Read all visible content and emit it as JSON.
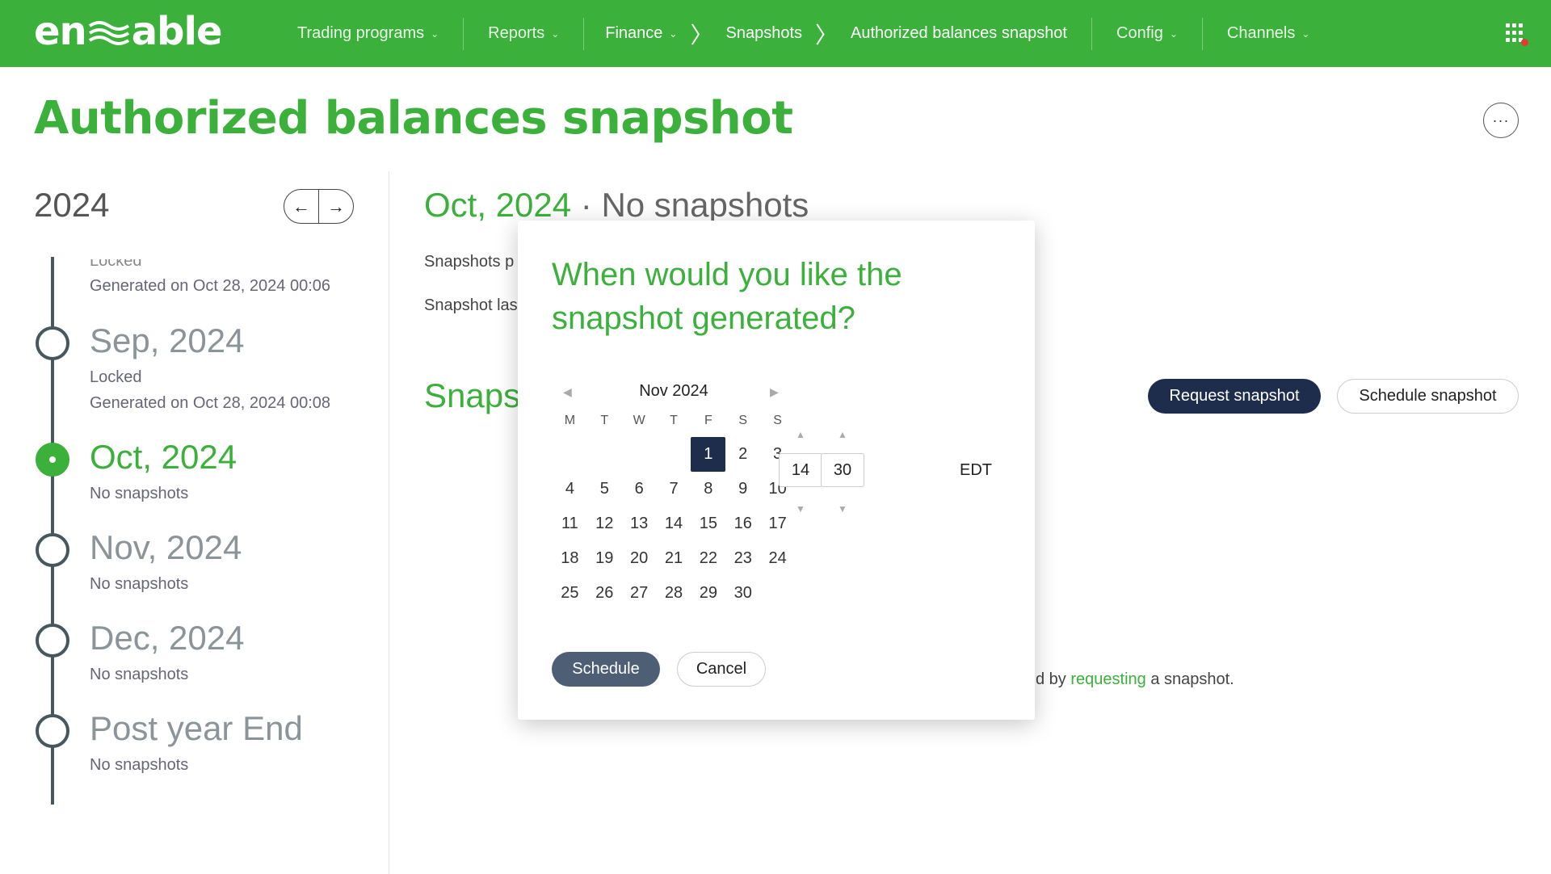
{
  "nav": {
    "logo_text_left": "en",
    "logo_text_right": "able",
    "items": [
      {
        "label": "Trading programs",
        "icon": "chevron-down-icon"
      },
      {
        "label": "Reports",
        "icon": "chevron-down-icon"
      }
    ],
    "breadcrumb": {
      "finance": "Finance",
      "snapshots": "Snapshots",
      "current": "Authorized balances snapshot"
    },
    "items_right": [
      {
        "label": "Config",
        "icon": "chevron-down-icon"
      },
      {
        "label": "Channels",
        "icon": "chevron-down-icon"
      }
    ],
    "apps_icon": "apps-grid-icon",
    "brand_color": "#3bb03b"
  },
  "page": {
    "title": "Authorized balances snapshot",
    "more_label": "···"
  },
  "sidebar": {
    "year": "2024",
    "prev_icon": "arrow-left-icon",
    "next_icon": "arrow-right-icon",
    "entries": [
      {
        "title": "",
        "status": "Locked",
        "generated": "Generated on Oct 28, 2024 00:06"
      },
      {
        "title": "Sep, 2024",
        "status": "Locked",
        "generated": "Generated on Oct 28, 2024 00:08"
      },
      {
        "title": "Oct, 2024",
        "status": "No snapshots",
        "active": true
      },
      {
        "title": "Nov, 2024",
        "status": "No snapshots"
      },
      {
        "title": "Dec, 2024",
        "status": "No snapshots"
      },
      {
        "title": "Post year End",
        "status": "No snapshots"
      }
    ]
  },
  "main": {
    "heading_month": "Oct, 2024",
    "heading_sep": " · ",
    "heading_status": "No snapshots",
    "info_1": "Snapshots p",
    "info_2": "Snapshot las",
    "section_title": "Snaps",
    "request_button": "Request snapshot",
    "schedule_button": "Schedule snapshot",
    "empty_prefix": "d by ",
    "empty_link": "requesting",
    "empty_suffix": " a snapshot."
  },
  "modal": {
    "title": "When would you like the snapshot generated?",
    "month_label": "Nov 2024",
    "weekday_heads": [
      "M",
      "T",
      "W",
      "T",
      "F",
      "S",
      "S"
    ],
    "weeks": [
      [
        "",
        "",
        "",
        "",
        "1",
        "2",
        "3"
      ],
      [
        "4",
        "5",
        "6",
        "7",
        "8",
        "9",
        "10"
      ],
      [
        "11",
        "12",
        "13",
        "14",
        "15",
        "16",
        "17"
      ],
      [
        "18",
        "19",
        "20",
        "21",
        "22",
        "23",
        "24"
      ],
      [
        "25",
        "26",
        "27",
        "28",
        "29",
        "30",
        ""
      ]
    ],
    "selected_day": "1",
    "hour": "14",
    "minute": "30",
    "timezone": "EDT",
    "schedule_button": "Schedule",
    "cancel_button": "Cancel",
    "selected_color": "#1f2d4d"
  }
}
